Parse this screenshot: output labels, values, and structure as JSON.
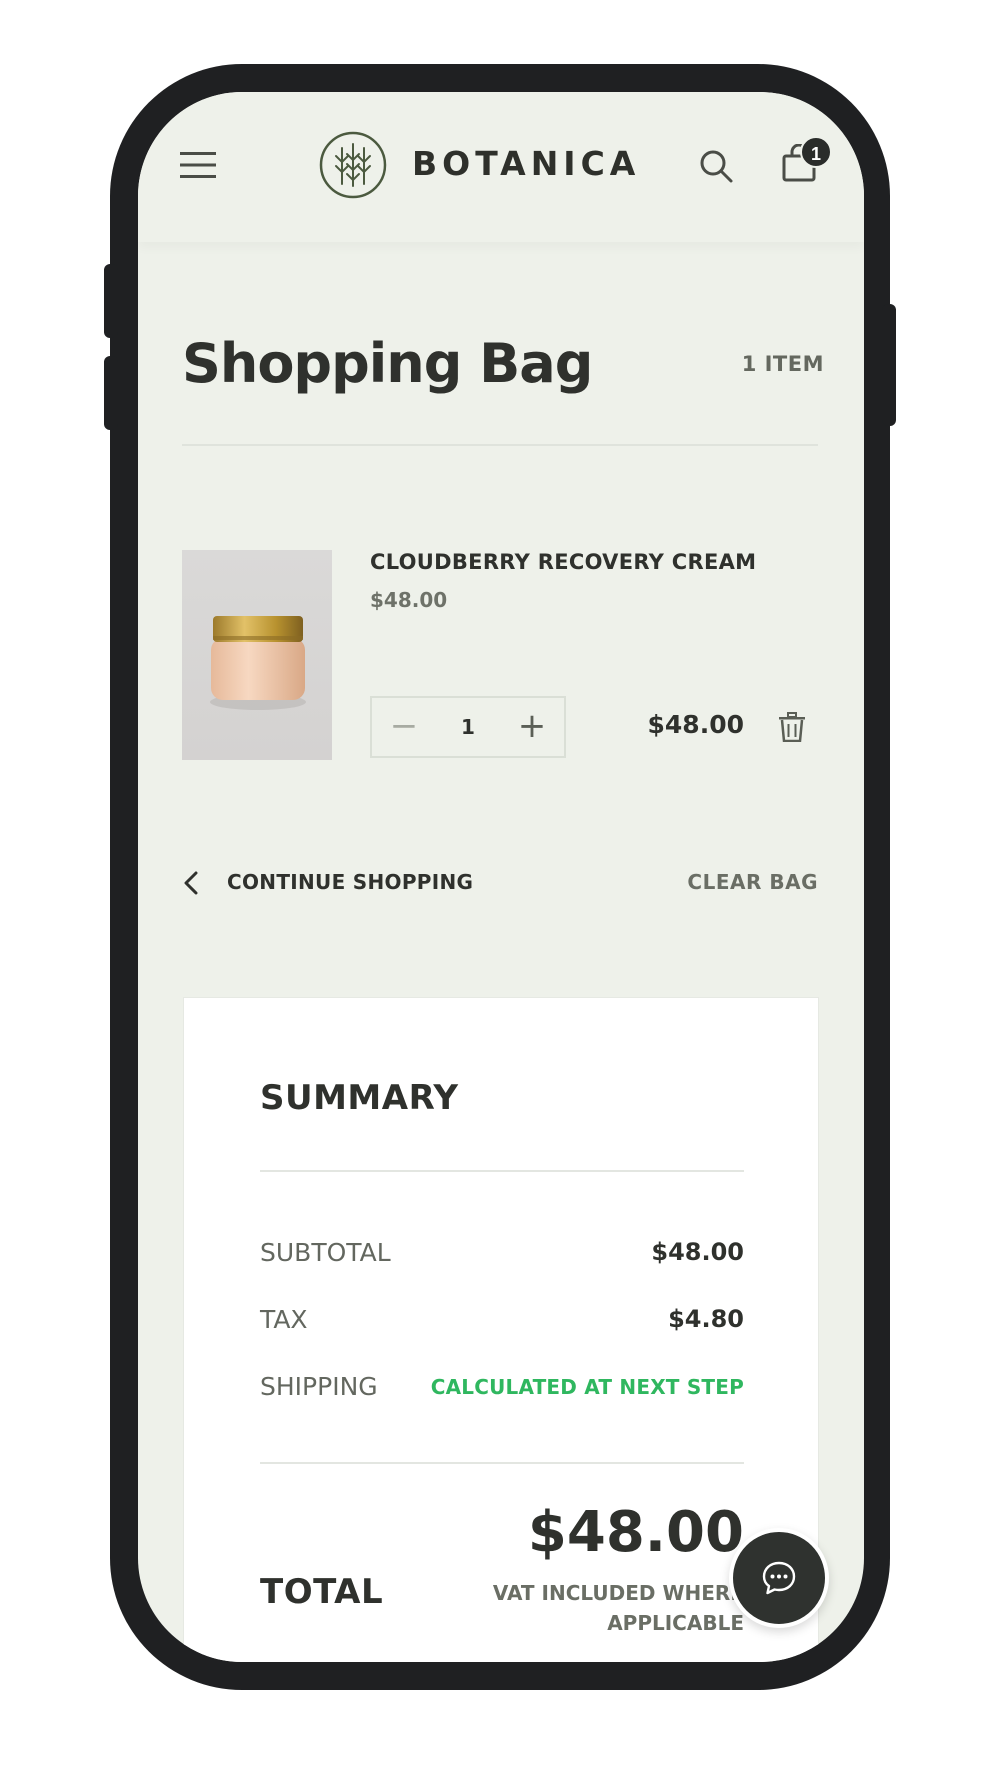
{
  "header": {
    "brand": "BOTANICA",
    "cart_count": "1",
    "icons": [
      "menu-icon",
      "logo-mark",
      "search-icon",
      "bag-icon"
    ]
  },
  "bag": {
    "title": "Shopping Bag",
    "item_count": "1 ITEM",
    "items": [
      {
        "name": "CLOUDBERRY RECOVERY CREAM",
        "unit_price": "$48.00",
        "quantity": "1",
        "line_total": "$48.00"
      }
    ],
    "continue_label": "CONTINUE SHOPPING",
    "clear_label": "CLEAR BAG"
  },
  "summary": {
    "title": "SUMMARY",
    "rows": [
      {
        "label": "SUBTOTAL",
        "value": "$48.00"
      },
      {
        "label": "TAX",
        "value": "$4.80"
      },
      {
        "label": "SHIPPING",
        "value": "CALCULATED AT NEXT STEP"
      }
    ],
    "total_label": "TOTAL",
    "total_value": "$48.00",
    "vat_note": "VAT INCLUDED WHERE APPLICABLE"
  },
  "colors": {
    "background": "#eef1ea",
    "text": "#2f312d",
    "muted": "#6a6e65",
    "accent_green": "#2fb75f",
    "frame": "#1f2022"
  }
}
